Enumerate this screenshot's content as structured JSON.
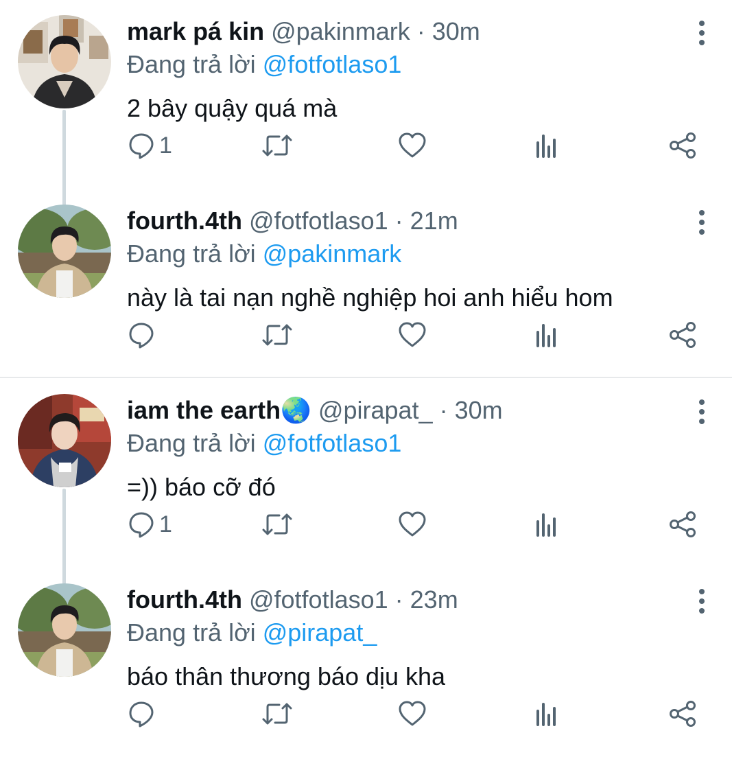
{
  "reply_prefix": "Đang trả lời",
  "colors": {
    "text": "#0f1419",
    "muted": "#536471",
    "link": "#1d9bf0",
    "divider": "#e7e9eb",
    "connector": "#cfd9de"
  },
  "icons": {
    "reply": "reply-icon",
    "retweet": "retweet-icon",
    "like": "heart-icon",
    "views": "views-icon",
    "share": "share-icon",
    "more": "more-options-icon"
  },
  "threads": [
    {
      "tweets": [
        {
          "display_name": "mark pá kin",
          "handle": "@pakinmark",
          "dot": " · ",
          "time": "30m",
          "replying_to": "@fotfotlaso1",
          "text": "2 bây quậy quá mà",
          "reply_count": "1"
        },
        {
          "display_name": "fourth.4th",
          "handle": "@fotfotlaso1",
          "dot": " · ",
          "time": "21m",
          "replying_to": "@pakinmark",
          "text": "này là tai nạn nghề nghiệp hoi anh hiểu hom",
          "reply_count": ""
        }
      ]
    },
    {
      "tweets": [
        {
          "display_name": "iam the earth🌏",
          "handle": "@pirapat_",
          "dot": " · ",
          "time": "30m",
          "replying_to": "@fotfotlaso1",
          "text": "=)) báo cỡ đó",
          "reply_count": "1"
        },
        {
          "display_name": "fourth.4th",
          "handle": "@fotfotlaso1",
          "dot": " · ",
          "time": "23m",
          "replying_to": "@pirapat_",
          "text": "báo thân thương báo dịu kha",
          "reply_count": ""
        }
      ]
    }
  ]
}
